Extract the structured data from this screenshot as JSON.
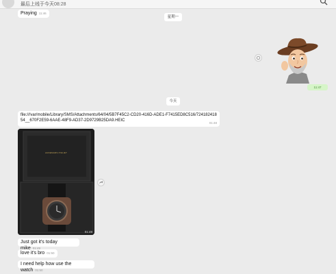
{
  "header": {
    "last_online": "最后上线于今天08:28"
  },
  "messages": {
    "praying": {
      "text": "Praying",
      "time": "11:46"
    },
    "sticker_time": "11:47",
    "file_path": {
      "text": "file:///var/mobile/Library/SMS/Attachments/64/04/5B7F45C2-CD20-416D-ADE1-F7415ED8C516/72418241854__670F2E59-6AAE-48F9-AD37-2D9729B25DA9.HEIC",
      "time": "01:48"
    },
    "photo_time": "01:49",
    "just_got": {
      "text": "Just got it's today mike",
      "time": "01:49"
    },
    "love": {
      "text": "love it's bro",
      "time": "01:50"
    },
    "need_help": {
      "text": "I need help how use the watch",
      "time": "01:50"
    }
  },
  "separators": {
    "wednesday": "星期一",
    "today": "今天"
  },
  "watch_box_brand": "AUDEMARS PIGUET",
  "icons": {
    "search": "search-icon",
    "sticker": "cowboy-memoji-sticker",
    "forward": "forward-icon",
    "sticker_action": "reaction-icon"
  },
  "colors": {
    "background": "#ebebeb",
    "bubble": "#ffffff",
    "sent_time_bg": "#d6f5c8"
  }
}
